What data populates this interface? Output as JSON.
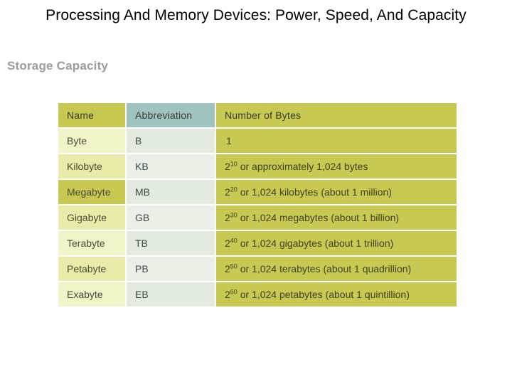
{
  "slide": {
    "title": "Processing And Memory Devices: Power, Speed, And Capacity",
    "subtitle": "Storage Capacity"
  },
  "table": {
    "name": "storage-capacity-table",
    "columns": [
      {
        "key": "name",
        "header": "Name"
      },
      {
        "key": "abbr",
        "header": "Abbreviation"
      },
      {
        "key": "bytes",
        "header": "Number of Bytes"
      }
    ],
    "rows": [
      {
        "name": "Byte",
        "abbr": "B",
        "bytes_base": "",
        "bytes_exp": "",
        "bytes_rest": "1"
      },
      {
        "name": "Kilobyte",
        "abbr": "KB",
        "bytes_base": "2",
        "bytes_exp": "10",
        "bytes_rest": " or approximately 1,024 bytes"
      },
      {
        "name": "Megabyte",
        "abbr": "MB",
        "bytes_base": "2",
        "bytes_exp": "20",
        "bytes_rest": " or 1,024 kilobytes (about 1 million)"
      },
      {
        "name": "Gigabyte",
        "abbr": "GB",
        "bytes_base": "2",
        "bytes_exp": "30",
        "bytes_rest": " or 1,024 megabytes (about 1 billion)"
      },
      {
        "name": "Terabyte",
        "abbr": "TB",
        "bytes_base": "2",
        "bytes_exp": "40",
        "bytes_rest": " or 1,024 gigabytes (about 1 trillion)"
      },
      {
        "name": "Petabyte",
        "abbr": "PB",
        "bytes_base": "2",
        "bytes_exp": "50",
        "bytes_rest": " or 1,024 terabytes (about 1 quadrillion)"
      },
      {
        "name": "Exabyte",
        "abbr": "EB",
        "bytes_base": "2",
        "bytes_exp": "60",
        "bytes_rest": " or 1,024 petabytes (about 1 quintillion)"
      }
    ]
  },
  "colors": {
    "header_name": "#c7c852",
    "header_abbr": "#9fc3bf",
    "header_bytes": "#c8c953",
    "bytes_cell": "#c8c953",
    "name_light": "#f1f3c8",
    "name_mid": "#e8eca8",
    "name_highlight": "#c7c852",
    "abbr_a": "#e3ebe1",
    "abbr_b": "#eaf0e7",
    "title_text": "#000000",
    "subtitle_text": "#9c9c9c",
    "background": "#ffffff"
  }
}
